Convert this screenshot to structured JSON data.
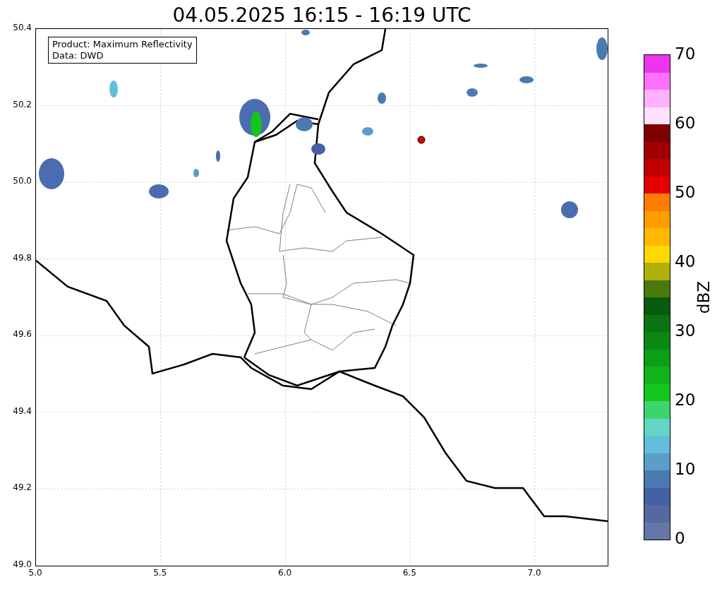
{
  "title": "04.05.2025 16:15 - 16:19 UTC",
  "info_box": {
    "lines": [
      "Product: Maximum Reflectivity",
      "Data: DWD"
    ]
  },
  "map": {
    "x_ticks": [
      "5.0",
      "5.5",
      "6.0",
      "6.5",
      "7.0"
    ],
    "y_ticks": [
      "50.4",
      "50.2",
      "50.0",
      "49.8",
      "49.6",
      "49.4",
      "49.2",
      "49.0"
    ]
  },
  "colorbar": {
    "label": "dBZ",
    "ticks": [
      "70",
      "60",
      "50",
      "40",
      "30",
      "20",
      "10",
      "0"
    ],
    "bands": [
      {
        "color": "#6577a6"
      },
      {
        "color": "#5568a0"
      },
      {
        "color": "#4560a3"
      },
      {
        "color": "#4b7ab0"
      },
      {
        "color": "#5b9ec8"
      },
      {
        "color": "#62bedb"
      },
      {
        "color": "#63d6c5"
      },
      {
        "color": "#3dd46e"
      },
      {
        "color": "#12c61d"
      },
      {
        "color": "#10b41a"
      },
      {
        "color": "#0c9e14"
      },
      {
        "color": "#0b8812"
      },
      {
        "color": "#0a7412"
      },
      {
        "color": "#095c0f"
      },
      {
        "color": "#4a7a0e"
      },
      {
        "color": "#b0b00a"
      },
      {
        "color": "#ffd800"
      },
      {
        "color": "#ffb800"
      },
      {
        "color": "#ff9c00"
      },
      {
        "color": "#ff7c00"
      },
      {
        "color": "#e60000"
      },
      {
        "color": "#c00000"
      },
      {
        "color": "#a00000"
      },
      {
        "color": "#7c0000"
      },
      {
        "color": "#ffe0ff"
      },
      {
        "color": "#ffb0ff"
      },
      {
        "color": "#ff70ff"
      },
      {
        "color": "#ee35ee"
      }
    ]
  }
}
